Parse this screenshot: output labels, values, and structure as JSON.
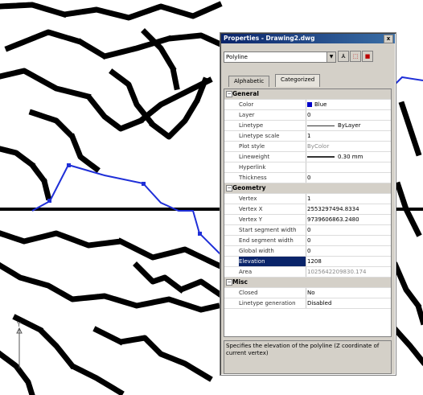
{
  "palette": {
    "title": "Properties - Drawing2.dwg",
    "close_label": "x",
    "selector_value": "Polyline",
    "tabs": [
      {
        "label": "Alphabetic"
      },
      {
        "label": "Categorized"
      }
    ],
    "categories": {
      "general": "General",
      "geometry": "Geometry",
      "misc": "Misc"
    },
    "general_rows": [
      {
        "name": "Color",
        "value": "Blue"
      },
      {
        "name": "Layer",
        "value": "0"
      },
      {
        "name": "Linetype",
        "value": "ByLayer"
      },
      {
        "name": "Linetype scale",
        "value": "1"
      },
      {
        "name": "Plot style",
        "value": "ByColor"
      },
      {
        "name": "Lineweight",
        "value": "0.30 mm"
      },
      {
        "name": "Hyperlink",
        "value": ""
      },
      {
        "name": "Thickness",
        "value": "0"
      }
    ],
    "geometry_rows": [
      {
        "name": "Vertex",
        "value": "1"
      },
      {
        "name": "Vertex X",
        "value": "2553297494.8334"
      },
      {
        "name": "Vertex Y",
        "value": "9739606863.2480"
      },
      {
        "name": "Start segment width",
        "value": "0"
      },
      {
        "name": "End segment width",
        "value": "0"
      },
      {
        "name": "Global width",
        "value": "0"
      },
      {
        "name": "Elevation",
        "value": "1208"
      },
      {
        "name": "Area",
        "value": "1025642209830.174"
      }
    ],
    "misc_rows": [
      {
        "name": "Closed",
        "value": "No"
      },
      {
        "name": "Linetype generation",
        "value": "Disabled"
      }
    ],
    "description": "Specifies the elevation of the polyline (Z coordinate of current vertex)"
  },
  "ucs": {
    "axis_label": "Y"
  },
  "colors": {
    "polyline": "#1f2fd8",
    "titlebar": "#0a246a",
    "selection": "#0a246a"
  }
}
